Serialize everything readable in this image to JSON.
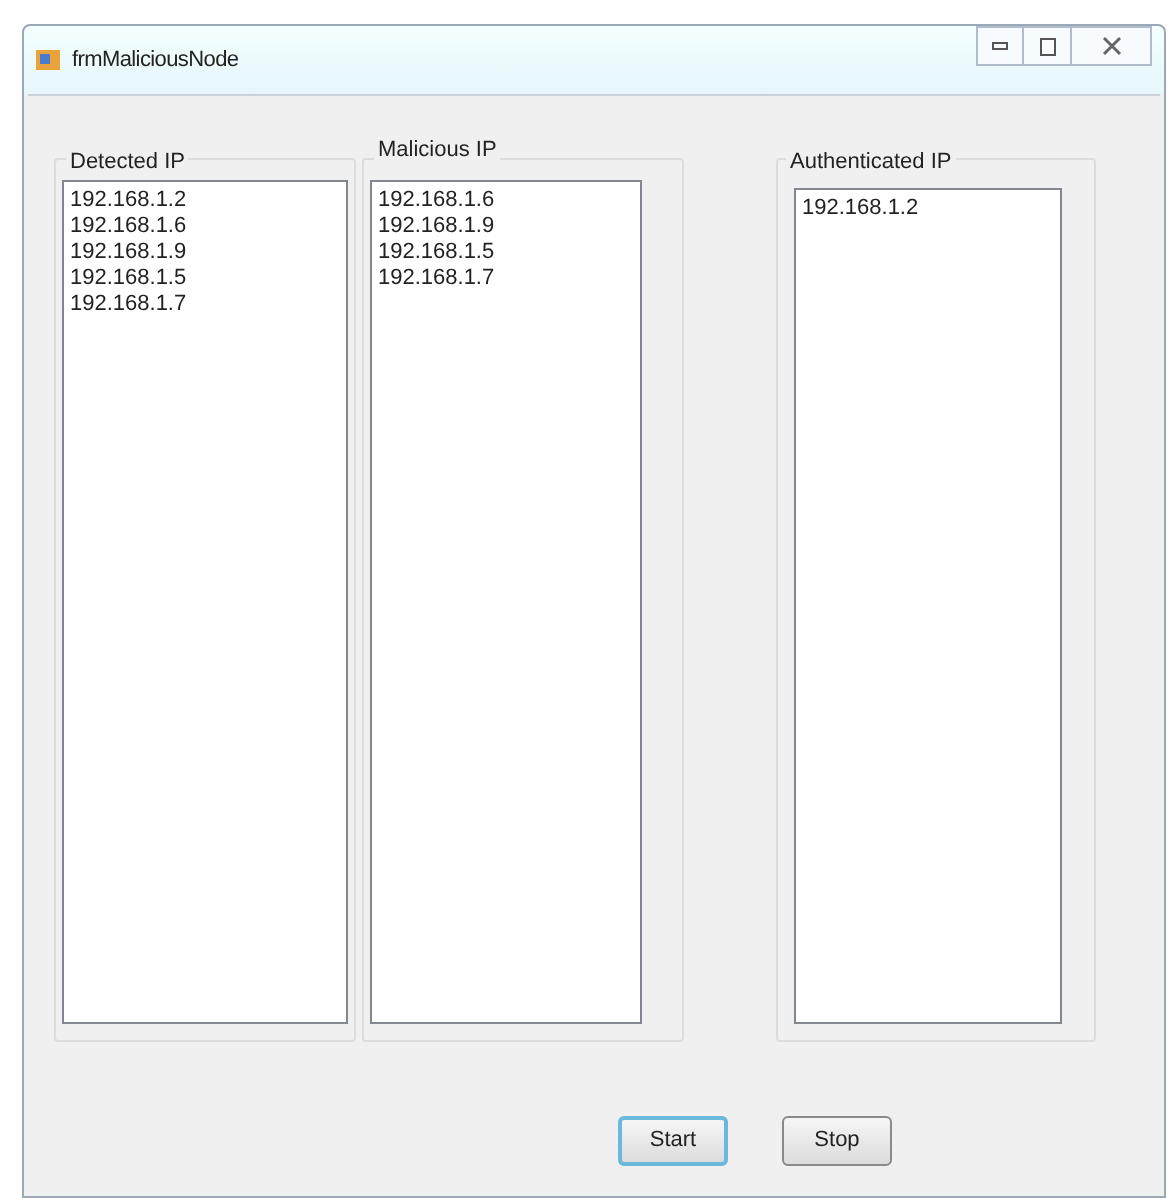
{
  "window": {
    "title": "frmMaliciousNode"
  },
  "groups": [
    {
      "title": "Detected IP",
      "items": [
        "192.168.1.2",
        "192.168.1.6",
        "192.168.1.9",
        "192.168.1.5",
        "192.168.1.7"
      ]
    },
    {
      "title": "Malicious IP",
      "items": [
        "192.168.1.6",
        "192.168.1.9",
        "192.168.1.5",
        "192.168.1.7"
      ]
    },
    {
      "title": "Authenticated IP",
      "items": [
        "192.168.1.2"
      ]
    }
  ],
  "buttons": [
    {
      "label": "Start",
      "focused": true
    },
    {
      "label": "Stop",
      "focused": false
    }
  ]
}
